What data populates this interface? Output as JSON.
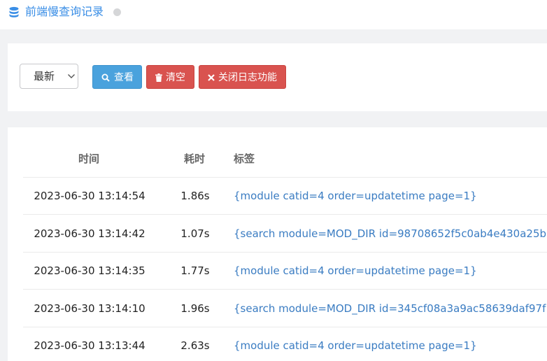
{
  "header": {
    "title": "前端慢查询记录",
    "icon": "database-icon"
  },
  "toolbar": {
    "select": {
      "value": "最新"
    },
    "buttons": {
      "view": "查看",
      "clear": "清空",
      "close_log": "关闭日志功能"
    }
  },
  "colors": {
    "accent": "#4aa2dd",
    "danger": "#d9534f",
    "link": "#3a7cc2"
  },
  "table": {
    "columns": [
      "时间",
      "耗时",
      "标签"
    ],
    "rows": [
      {
        "time": "2023-06-30 13:14:54",
        "duration": "1.86s",
        "tag": "{module catid=4 order=updatetime page=1}"
      },
      {
        "time": "2023-06-30 13:14:42",
        "duration": "1.07s",
        "tag": "{search module=MOD_DIR id=98708652f5c0ab4e430a25b"
      },
      {
        "time": "2023-06-30 13:14:35",
        "duration": "1.77s",
        "tag": "{module catid=4 order=updatetime page=1}"
      },
      {
        "time": "2023-06-30 13:14:10",
        "duration": "1.96s",
        "tag": "{search module=MOD_DIR id=345cf08a3a9ac58639daf97f"
      },
      {
        "time": "2023-06-30 13:13:44",
        "duration": "2.63s",
        "tag": "{module catid=4 order=updatetime page=1}"
      }
    ]
  }
}
